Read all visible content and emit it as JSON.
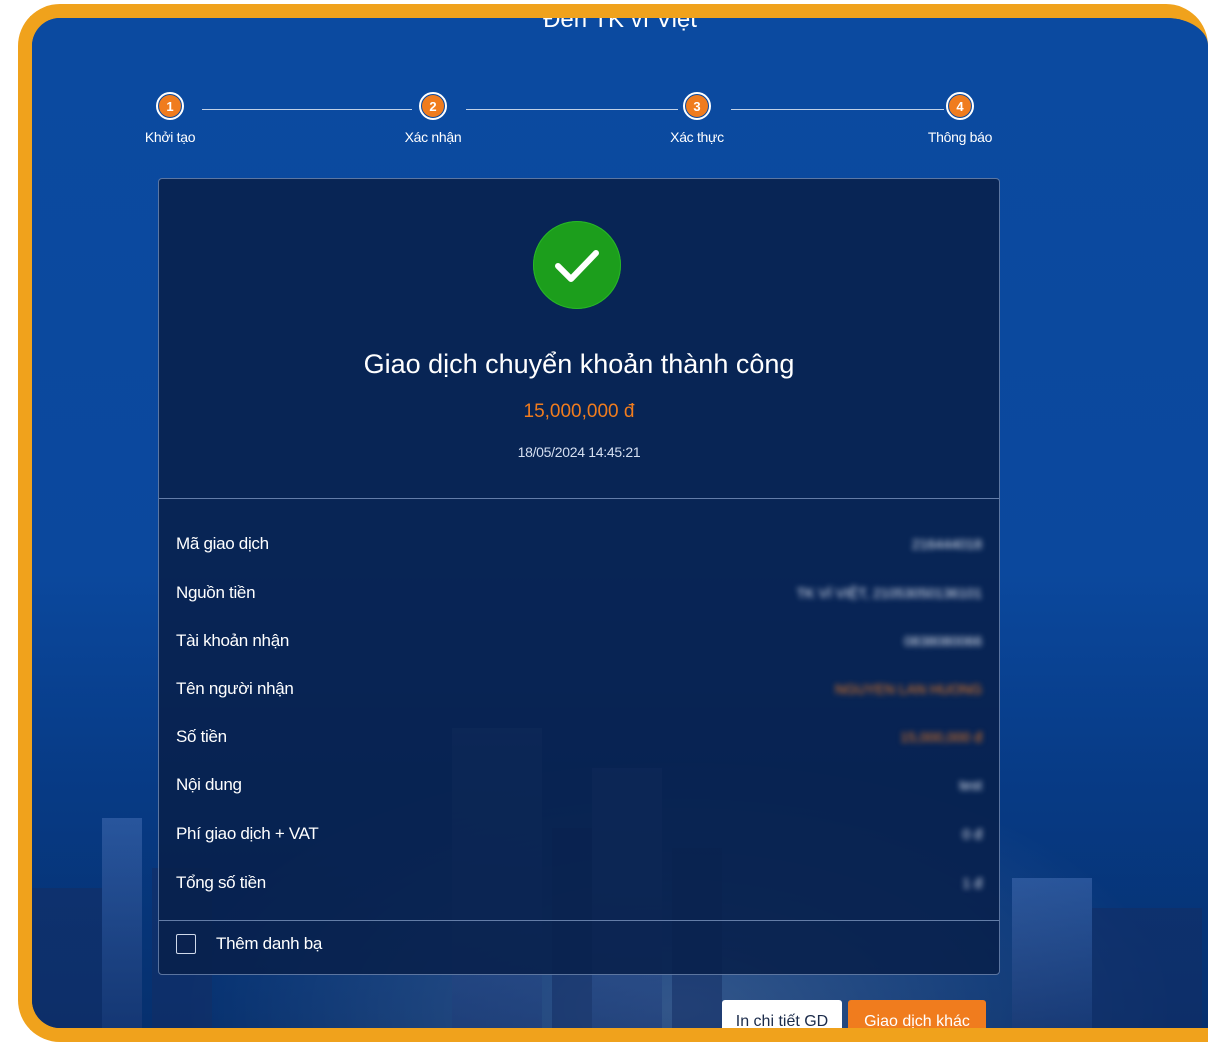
{
  "page": {
    "heading": "Đến TK ví Việt"
  },
  "stepper": {
    "steps": [
      {
        "number": "1",
        "label": "Khởi tạo"
      },
      {
        "number": "2",
        "label": "Xác nhận"
      },
      {
        "number": "3",
        "label": "Xác thực"
      },
      {
        "number": "4",
        "label": "Thông báo"
      }
    ]
  },
  "result": {
    "icon": "success-check-icon",
    "title": "Giao dịch chuyển khoản thành công",
    "amount": "15,000,000 đ",
    "datetime": "18/05/2024 14:45:21"
  },
  "details": [
    {
      "label": "Mã giao dịch",
      "value": "216444018"
    },
    {
      "label": "Nguồn tiền",
      "value": "TK VÍ VIỆT, 21053050136101"
    },
    {
      "label": "Tài khoản nhận",
      "value": "0838080066"
    },
    {
      "label": "Tên người nhận",
      "value": "NGUYEN LAN HUONG"
    },
    {
      "label": "Số tiền",
      "value": "15,000,000 đ"
    },
    {
      "label": "Nội dung",
      "value": "test"
    },
    {
      "label": "Phí giao dịch + VAT",
      "value": "0 đ"
    },
    {
      "label": "Tổng số tiền",
      "value": "1 đ"
    }
  ],
  "contact": {
    "label": "Thêm danh bạ",
    "checked": false
  },
  "buttons": {
    "print": "In chi tiết GD",
    "other": "Giao dịch khác"
  },
  "colors": {
    "accent": "#f07c1e",
    "frame": "#f0a21c",
    "success": "#1c9e1c",
    "background": "#0b4aa0"
  }
}
